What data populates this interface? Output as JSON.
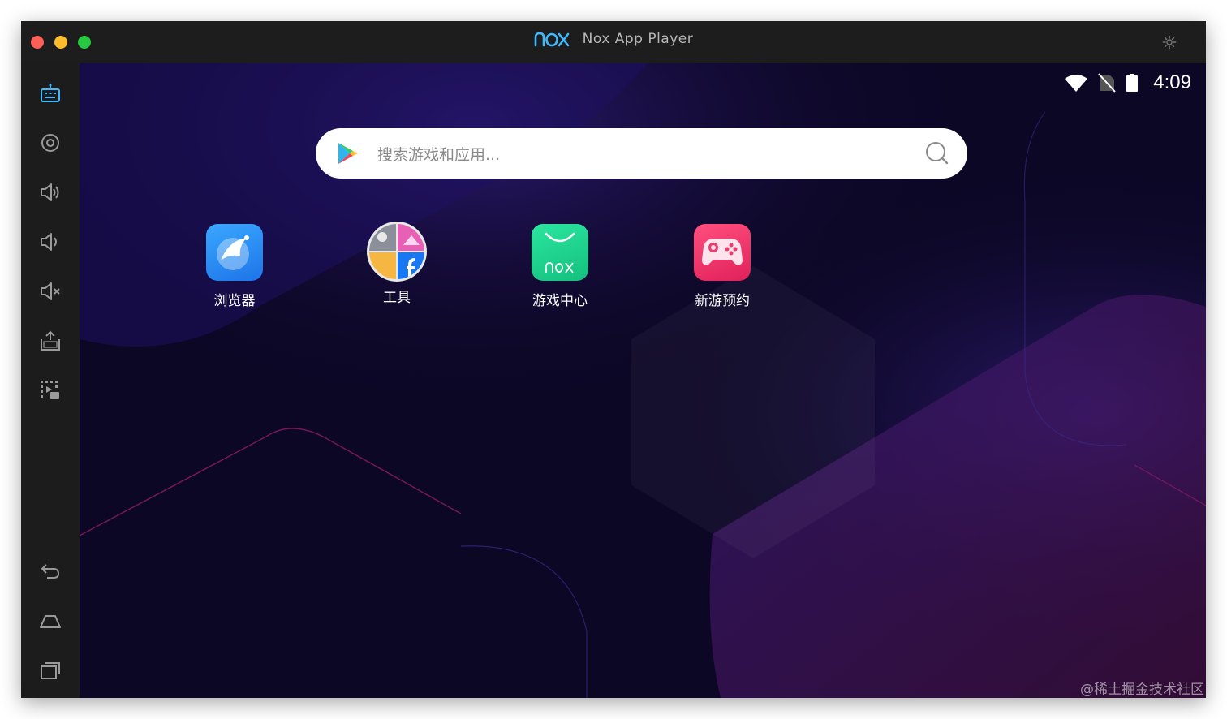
{
  "window": {
    "title": "Nox App Player",
    "logo_text": "nox"
  },
  "sidebar": {
    "items": [
      {
        "name": "keyboard-mapping",
        "icon": "robot-keyboard-icon"
      },
      {
        "name": "location",
        "icon": "location-icon"
      },
      {
        "name": "volume-up",
        "icon": "volume-up-icon"
      },
      {
        "name": "volume-down",
        "icon": "volume-down-icon"
      },
      {
        "name": "mute",
        "icon": "mute-icon"
      },
      {
        "name": "install-apk",
        "icon": "apk-install-icon"
      },
      {
        "name": "screen-record",
        "icon": "multi-instance-icon"
      }
    ],
    "bottom_items": [
      {
        "name": "back",
        "icon": "back-icon"
      },
      {
        "name": "home",
        "icon": "home-icon"
      },
      {
        "name": "recent-apps",
        "icon": "recent-apps-icon"
      }
    ]
  },
  "status_bar": {
    "time": "4:09",
    "icons": [
      "wifi-icon",
      "no-sim-icon",
      "battery-icon"
    ]
  },
  "search": {
    "placeholder": "搜索游戏和应用..."
  },
  "apps": [
    {
      "label": "浏览器",
      "icon": "browser-icon",
      "color": "#2e8cf2"
    },
    {
      "label": "工具",
      "icon": "tools-folder-icon",
      "color": "#d6d6d6"
    },
    {
      "label": "游戏中心",
      "icon": "game-center-icon",
      "color": "#20d592"
    },
    {
      "label": "新游预约",
      "icon": "gamepad-icon",
      "color": "#f0386a"
    }
  ],
  "watermark": "@稀土掘金技术社区",
  "colors": {
    "screen_bg": "#0c0725",
    "chrome": "#1d1d1d",
    "accent": "#3fb9ff"
  }
}
